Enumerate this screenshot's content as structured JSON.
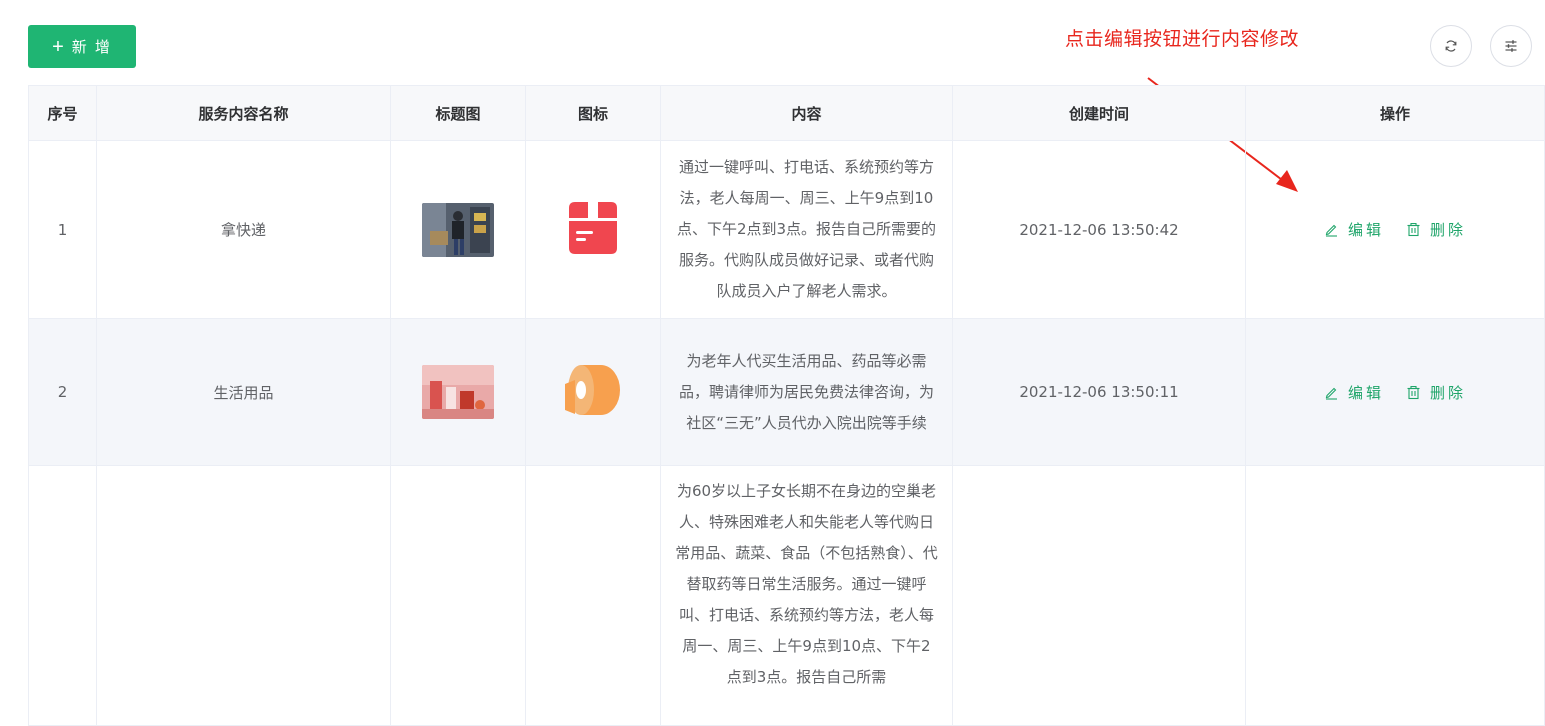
{
  "toolbar": {
    "add_label": "新 增",
    "add_icon": "plus-icon",
    "refresh_icon": "refresh-icon",
    "column_settings_icon": "sliders-icon",
    "accent_color": "#1fb573"
  },
  "annotation": {
    "text": "点击编辑按钮进行内容修改",
    "color": "#e8261d"
  },
  "table": {
    "headers": [
      "序号",
      "服务内容名称",
      "标题图",
      "图标",
      "内容",
      "创建时间",
      "操作"
    ],
    "rows": [
      {
        "index": "1",
        "name": "拿快递",
        "thumb_icon": "delivery-photo",
        "icon": "package-icon",
        "icon_color": "#f0464f",
        "content": "通过一键呼叫、打电话、系统预约等方法，老人每周一、周三、上午9点到10点、下午2点到3点。报告自己所需要的服务。代购队成员做好记录、或者代购队成员入户了解老人需求。",
        "created": "2021-12-06 13:50:42",
        "edit_label": "编辑",
        "delete_label": "删除"
      },
      {
        "index": "2",
        "name": "生活用品",
        "thumb_icon": "household-products-photo",
        "icon": "tissue-roll-icon",
        "icon_color": "#f7a04e",
        "content": "为老年人代买生活用品、药品等必需品，聘请律师为居民免费法律咨询，为社区“三无”人员代办入院出院等手续",
        "created": "2021-12-06 13:50:11",
        "edit_label": "编辑",
        "delete_label": "删除"
      },
      {
        "index": "",
        "name": "",
        "content": "为60岁以上子女长期不在身边的空巢老人、特殊困难老人和失能老人等代购日常用品、蔬菜、食品（不包括熟食）、代替取药等日常生活服务。通过一键呼叫、打电话、系统预约等方法，老人每周一、周三、上午9点到10点、下午2点到3点。报告自己所需",
        "created": ""
      }
    ]
  }
}
